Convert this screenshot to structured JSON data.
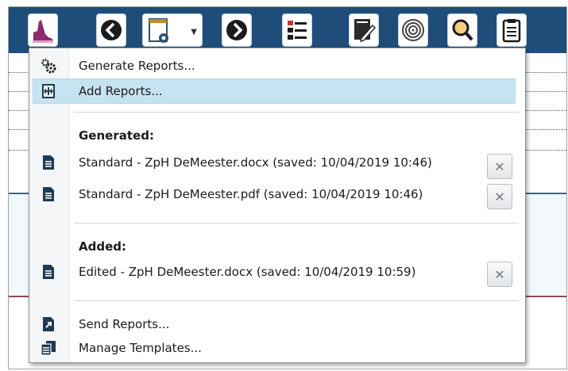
{
  "menu": {
    "actions_top": [
      {
        "label": "Generate Reports...",
        "icon": "gears-icon"
      },
      {
        "label": "Add Reports...",
        "icon": "add-report-icon",
        "highlighted": true
      }
    ],
    "generated": {
      "heading": "Generated:",
      "items": [
        {
          "label": "Standard - ZpH DeMeester.docx (saved: 10/04/2019 10:46)",
          "icon": "document-icon"
        },
        {
          "label": "Standard - ZpH DeMeester.pdf (saved: 10/04/2019 10:46)",
          "icon": "document-icon"
        }
      ]
    },
    "added": {
      "heading": "Added:",
      "items": [
        {
          "label": "Edited - ZpH DeMeester.docx (saved: 10/04/2019 10:59)",
          "icon": "document-icon"
        }
      ]
    },
    "actions_bottom": [
      {
        "label": "Send Reports...",
        "icon": "send-report-icon"
      },
      {
        "label": "Manage Templates...",
        "icon": "templates-icon"
      }
    ],
    "remove_glyph": "✕"
  },
  "colors": {
    "toolbar_bg": "#1f4d7a",
    "highlight_bg": "#c6e3f2",
    "menu_gutter": "#f5f6f7"
  }
}
